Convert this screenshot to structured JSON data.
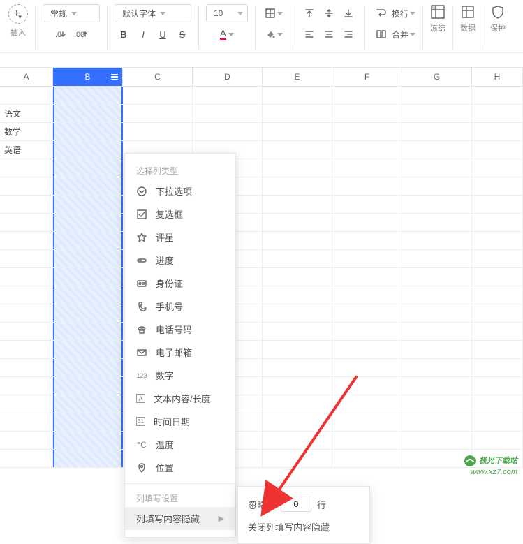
{
  "toolbar": {
    "insert_label": "插入",
    "style_combo": "常规",
    "font_combo": "默认字体",
    "size_combo": "10",
    "decimal_dec": ".0",
    "decimal_inc": ".00",
    "wrap_label": "换行",
    "merge_label": "合并",
    "freeze_label": "冻结",
    "data_label": "数据",
    "protect_label": "保护"
  },
  "columns": [
    "A",
    "B",
    "C",
    "D",
    "E",
    "F",
    "G",
    "H"
  ],
  "selected_col": "B",
  "data_rows": [
    "",
    "语文",
    "数学",
    "英语"
  ],
  "menu": {
    "section1": "选择列类型",
    "items": [
      {
        "label": "下拉选项"
      },
      {
        "label": "复选框"
      },
      {
        "label": "评星"
      },
      {
        "label": "进度"
      },
      {
        "label": "身份证"
      },
      {
        "label": "手机号"
      },
      {
        "label": "电话号码"
      },
      {
        "label": "电子邮箱"
      },
      {
        "label": "数字",
        "icon_text": "123"
      },
      {
        "label": "文本内容/长度",
        "icon_text": "A"
      },
      {
        "label": "时间日期",
        "icon_text": "31"
      },
      {
        "label": "温度",
        "icon_text": "°C"
      },
      {
        "label": "位置"
      }
    ],
    "section2": "列填写设置",
    "hide_item": "列填写内容隐藏"
  },
  "submenu": {
    "ignore_prefix": "忽略前",
    "ignore_value": "0",
    "ignore_suffix": "行",
    "close_label": "关闭列填写内容隐藏"
  },
  "watermark": {
    "name": "极光下载站",
    "url": "www.xz7.com"
  }
}
